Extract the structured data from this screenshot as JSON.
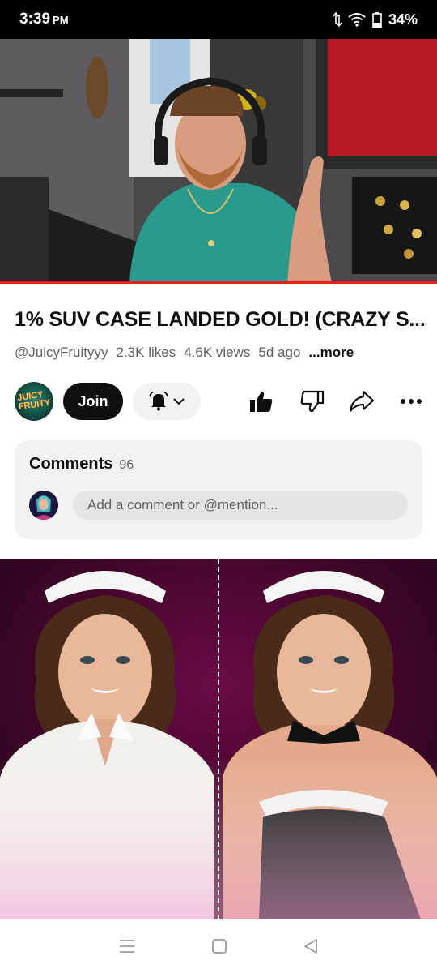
{
  "status": {
    "time": "3:39",
    "ampm": "PM",
    "battery": "34%"
  },
  "video": {
    "title": "1% SUV CASE LANDED GOLD! (CRAZY S...",
    "channel": "@JuicyFruityyy",
    "likes": "2.3K likes",
    "views": "4.6K views",
    "age": "5d ago",
    "more_label": "...more"
  },
  "actions": {
    "join_label": "Join",
    "icons": [
      "bell-icon",
      "chevron-down-icon",
      "thumbs-up-icon",
      "thumbs-down-icon",
      "share-icon",
      "more-icon"
    ]
  },
  "channel_avatar_text": "JUICY FRUITY",
  "comments": {
    "label": "Comments",
    "count": "96",
    "placeholder": "Add a comment or @mention..."
  },
  "colors": {
    "progress": "#e62117",
    "join_bg": "#0f0f0f",
    "card_bg": "#f2f2f2"
  }
}
